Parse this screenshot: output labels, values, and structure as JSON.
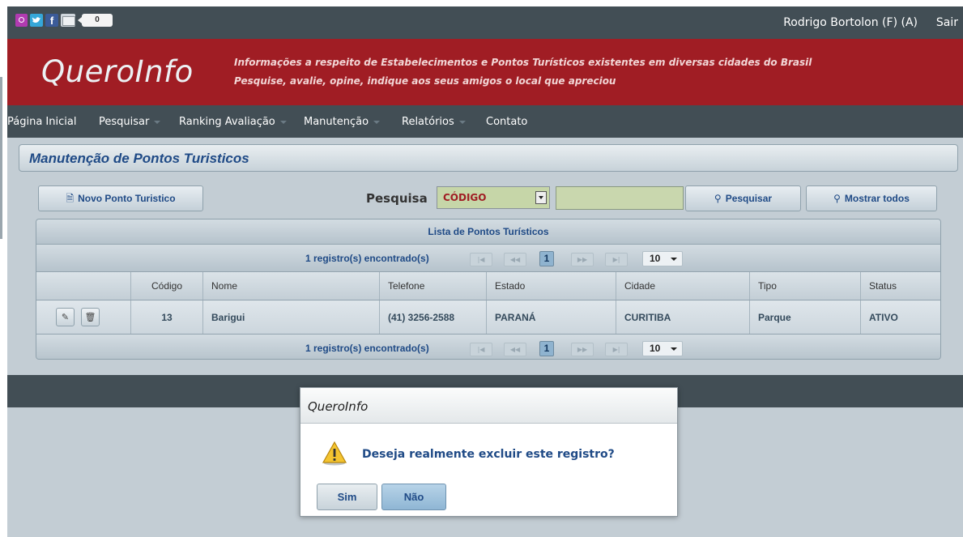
{
  "social": {
    "icons": [
      "orkut-icon",
      "twitter-icon",
      "facebook-icon",
      "email-icon"
    ],
    "facebook_glyph": "f",
    "share_count": "0"
  },
  "user": {
    "name": "Rodrigo Bortolon (F) (A)",
    "logout_label": "Sair"
  },
  "banner": {
    "logo": "QueroInfo",
    "tagline_1": "Informações a respeito de Estabelecimentos e Pontos Turísticos existentes em diversas cidades do Brasil",
    "tagline_2": "Pesquise, avalie, opine, indique aos seus amigos o local que apreciou"
  },
  "menu": {
    "items": [
      {
        "label": "Página Inicial",
        "has_caret": false
      },
      {
        "label": "Pesquisar",
        "has_caret": true
      },
      {
        "label": "Ranking Avaliação",
        "has_caret": true
      },
      {
        "label": "Manutenção",
        "has_caret": true
      },
      {
        "label": "Relatórios",
        "has_caret": true
      },
      {
        "label": "Contato",
        "has_caret": false
      }
    ]
  },
  "panel": {
    "title": "Manutenção de Pontos Turisticos"
  },
  "toolbar": {
    "new_label": "Novo Ponto Turistico",
    "search_label": "Pesquisa",
    "search_field_value": "CÓDIGO",
    "search_input_value": "",
    "search_button": "Pesquisar",
    "show_all_button": "Mostrar todos"
  },
  "table": {
    "caption": "Lista de Pontos Turísticos",
    "records_found": "1 registro(s) encontrado(s)",
    "current_page": "1",
    "rows_per_page": "10",
    "columns": [
      "Código",
      "Nome",
      "Telefone",
      "Estado",
      "Cidade",
      "Tipo",
      "Status"
    ],
    "rows": [
      {
        "codigo": "13",
        "nome": "Barigui",
        "telefone": "(41) 3256-2588",
        "estado": "PARANÁ",
        "cidade": "CURITIBA",
        "tipo": "Parque",
        "status": "ATIVO"
      }
    ]
  },
  "dialog": {
    "title": "QueroInfo",
    "message": "Deseja realmente excluir este registro?",
    "confirm_label": "Sim",
    "cancel_label": "Não"
  },
  "colors": {
    "banner_red": "#a01d24",
    "dark_bar": "#424e55",
    "background": "#c3cdd4",
    "accent_blue": "#1f4a86"
  }
}
